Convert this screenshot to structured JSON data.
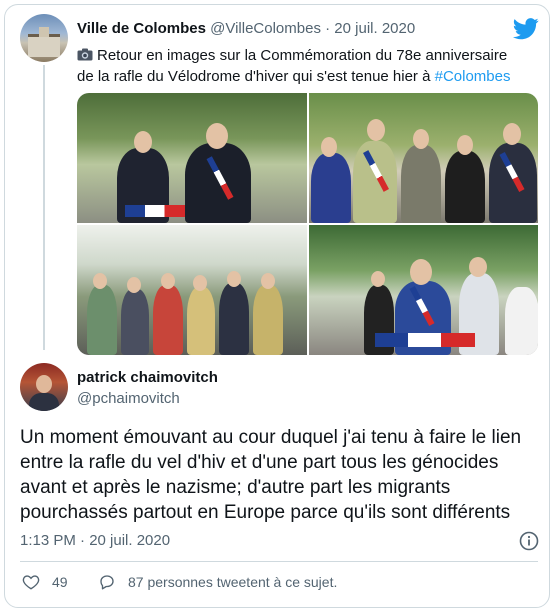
{
  "quoted_tweet": {
    "author_name": "Ville de Colombes",
    "author_handle": "@VilleColombes",
    "separator": "·",
    "date": "20 juil. 2020",
    "text_before_hashtag": "Retour en images sur la Commémoration du 78e anniversaire de la rafle du Vélodrome d'hiver qui s'est tenue hier à ",
    "hashtag": "#Colombes",
    "photo_count": 4
  },
  "main_tweet": {
    "author_name": "patrick chaimovitch",
    "author_handle": "@pchaimovitch",
    "text": "Un moment émouvant au cour duquel j'ai tenu à  faire le lien entre la rafle du vel d'hiv et d'une part tous les génocides avant et après le nazisme; d'autre part les migrants pourchassés partout en Europe parce qu'ils sont différents",
    "timestamp": "1:13 PM · 20 juil. 2020"
  },
  "actions": {
    "like_count": "49",
    "reply_text": "87 personnes tweetent à ce sujet."
  },
  "colors": {
    "brand": "#1d9bf0",
    "text": "#0f1419",
    "muted": "#536471",
    "border": "#cfd9de"
  },
  "icons": [
    "twitter-logo-icon",
    "camera-icon",
    "info-icon",
    "heart-icon",
    "reply-bubble-icon"
  ]
}
